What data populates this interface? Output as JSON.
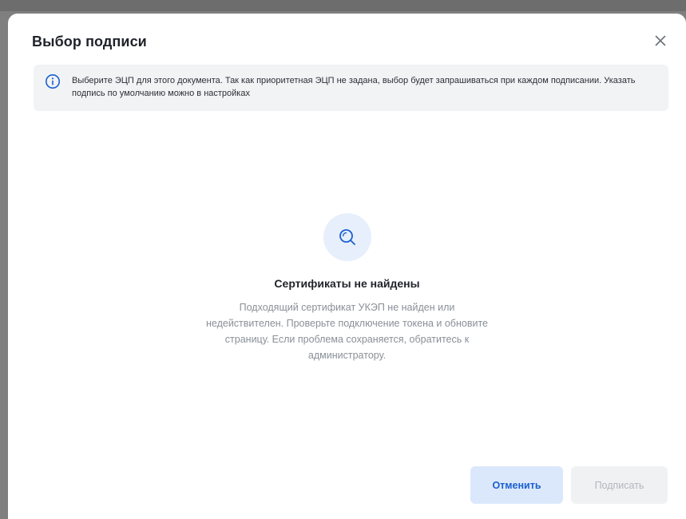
{
  "dialog": {
    "title": "Выбор подписи",
    "close_icon": "close-icon"
  },
  "info": {
    "icon": "info-icon",
    "text": "Выберите ЭЦП для этого документа. Так как приоритетная ЭЦП не задана, выбор будет запрашиваться при каждом подписании. Указать подпись по умолчанию можно в настройках"
  },
  "empty_state": {
    "icon": "search-icon",
    "title": "Сертификаты не найдены",
    "description": "Подходящий сертификат УКЭП не найден или недействителен. Проверьте подключение токена и обновите страницу. Если проблема сохраняется, обратитесь к администратору."
  },
  "actions": {
    "cancel_label": "Отменить",
    "sign_label": "Подписать"
  },
  "colors": {
    "accent": "#1b5fd0",
    "cancel_bg": "#dbe8fb",
    "disabled_bg": "#f0f1f3",
    "banner_bg": "#f1f3f5"
  }
}
